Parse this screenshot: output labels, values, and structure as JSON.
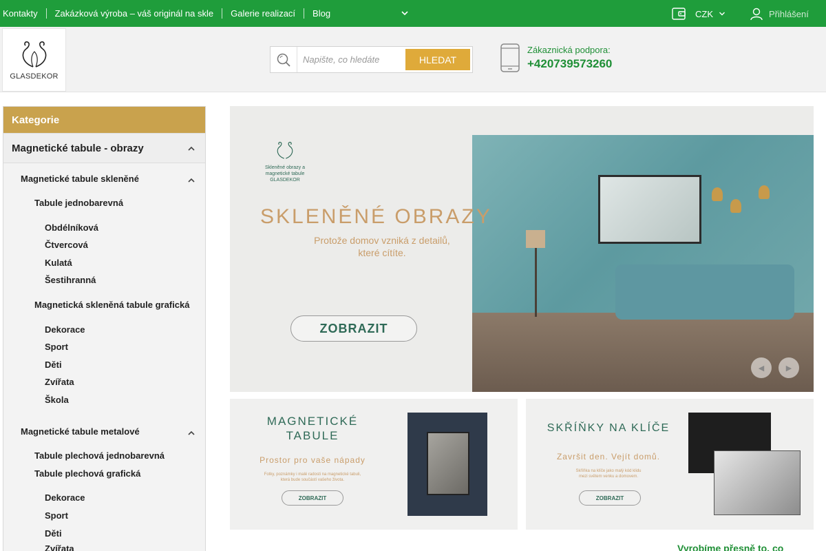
{
  "topnav": {
    "links": [
      "Kontakty",
      "Zakázková výroba – váš originál na skle",
      "Galerie realizací",
      "Blog"
    ],
    "currency": "CZK",
    "login": "Přihlášení"
  },
  "header": {
    "logo_text": "GLASDEKOR",
    "search": {
      "placeholder": "Napište, co hledáte",
      "button": "HLEDAT"
    },
    "support": {
      "label": "Zákaznická podpora:",
      "phone": "+420739573260"
    }
  },
  "sidebar": {
    "title": "Kategorie",
    "level1": "Magnetické tabule - obrazy",
    "glass": {
      "label": "Magnetické tabule skleněné",
      "solid": "Tabule jednobarevná",
      "solid_items": [
        "Obdélníková",
        "Čtvercová",
        "Kulatá",
        "Šestihranná"
      ],
      "graphic": "Magnetická skleněná tabule grafická",
      "graphic_items": [
        "Dekorace",
        "Sport",
        "Děti",
        "Zvířata",
        "Škola"
      ]
    },
    "metal": {
      "label": "Magnetické tabule metalové",
      "solid": "Tabule plechová jednobarevná",
      "graphic": "Tabule plechová grafická",
      "graphic_items": [
        "Dekorace",
        "Sport",
        "Děti",
        "Zvířata"
      ]
    }
  },
  "hero": {
    "mini_logo": [
      "Skleněné obrazy a",
      "magnetické tabule",
      "GLASDEKOR"
    ],
    "title": "SKLENĚNÉ OBRAZY",
    "subtitle_1": "Protože domov vzniká z detailů,",
    "subtitle_2": "které cítíte.",
    "button": "ZOBRAZIT"
  },
  "banner_magnetic": {
    "title_1": "MAGNETICKÉ",
    "title_2": "TABULE",
    "subtitle": "Prostor pro vaše nápady",
    "small_1": "Fotky, poznámky i malé radosti na magnetické tabuli,",
    "small_2": "která bude součástí vašeho života.",
    "button": "ZOBRAZIT"
  },
  "banner_keys": {
    "title": "SKŘÍŇKY NA KLÍČE",
    "subtitle": "Završit den. Vejít domů.",
    "small_1": "Skříňka na klíče jako malý kód klidu",
    "small_2": "mezi světem venku a domovem.",
    "button": "ZOBRAZIT"
  },
  "tagline": "Vyrobíme přesně to, co"
}
